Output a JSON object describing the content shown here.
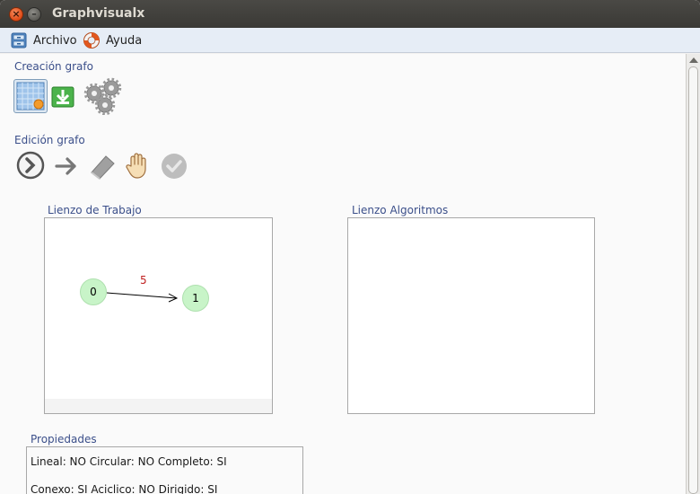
{
  "window": {
    "title": "Graphvisualx"
  },
  "menubar": {
    "items": [
      {
        "label": "Archivo",
        "icon": "cabinet-icon"
      },
      {
        "label": "Ayuda",
        "icon": "lifebuoy-icon"
      }
    ]
  },
  "creation": {
    "label": "Creación grafo",
    "tools": [
      "new-graph-icon",
      "download-icon",
      "gears-icon"
    ]
  },
  "edition": {
    "label": "Edición grafo",
    "tools": [
      "select-circle-arrow-icon",
      "arrow-right-icon",
      "eraser-icon",
      "hand-icon",
      "check-icon"
    ]
  },
  "canvases": {
    "work": {
      "label": "Lienzo de Trabajo",
      "nodes": [
        {
          "id": "0"
        },
        {
          "id": "1"
        }
      ],
      "edges": [
        {
          "from": "0",
          "to": "1",
          "weight": "5"
        }
      ]
    },
    "algorithms": {
      "label": "Lienzo Algoritmos"
    }
  },
  "properties": {
    "label": "Propiedades",
    "line1": "Lineal: NO  Circular: NO  Completo: SI",
    "line2": "Conexo: SI   Aciclico: NO  Dirigido: SI"
  },
  "colors": {
    "node_fill": "#c8f4c8",
    "edge_weight": "#c02020",
    "section_label": "#3b4f8a"
  }
}
